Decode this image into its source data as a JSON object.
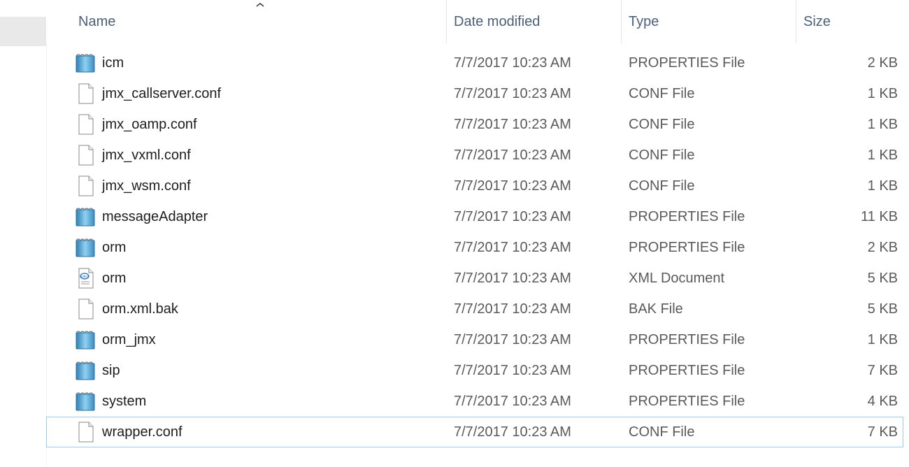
{
  "columns": {
    "name": "Name",
    "date": "Date modified",
    "type": "Type",
    "size": "Size"
  },
  "files": [
    {
      "name": "icm",
      "date": "7/7/2017 10:23 AM",
      "type": "PROPERTIES File",
      "size": "2 KB",
      "icon": "properties-file-icon"
    },
    {
      "name": "jmx_callserver.conf",
      "date": "7/7/2017 10:23 AM",
      "type": "CONF File",
      "size": "1 KB",
      "icon": "blank-file-icon"
    },
    {
      "name": "jmx_oamp.conf",
      "date": "7/7/2017 10:23 AM",
      "type": "CONF File",
      "size": "1 KB",
      "icon": "blank-file-icon"
    },
    {
      "name": "jmx_vxml.conf",
      "date": "7/7/2017 10:23 AM",
      "type": "CONF File",
      "size": "1 KB",
      "icon": "blank-file-icon"
    },
    {
      "name": "jmx_wsm.conf",
      "date": "7/7/2017 10:23 AM",
      "type": "CONF File",
      "size": "1 KB",
      "icon": "blank-file-icon"
    },
    {
      "name": "messageAdapter",
      "date": "7/7/2017 10:23 AM",
      "type": "PROPERTIES File",
      "size": "11 KB",
      "icon": "properties-file-icon"
    },
    {
      "name": "orm",
      "date": "7/7/2017 10:23 AM",
      "type": "PROPERTIES File",
      "size": "2 KB",
      "icon": "properties-file-icon"
    },
    {
      "name": "orm",
      "date": "7/7/2017 10:23 AM",
      "type": "XML Document",
      "size": "5 KB",
      "icon": "xml-document-icon"
    },
    {
      "name": "orm.xml.bak",
      "date": "7/7/2017 10:23 AM",
      "type": "BAK File",
      "size": "5 KB",
      "icon": "blank-file-icon"
    },
    {
      "name": "orm_jmx",
      "date": "7/7/2017 10:23 AM",
      "type": "PROPERTIES File",
      "size": "1 KB",
      "icon": "properties-file-icon"
    },
    {
      "name": "sip",
      "date": "7/7/2017 10:23 AM",
      "type": "PROPERTIES File",
      "size": "7 KB",
      "icon": "properties-file-icon"
    },
    {
      "name": "system",
      "date": "7/7/2017 10:23 AM",
      "type": "PROPERTIES File",
      "size": "4 KB",
      "icon": "properties-file-icon"
    },
    {
      "name": "wrapper.conf",
      "date": "7/7/2017 10:23 AM",
      "type": "CONF File",
      "size": "7 KB",
      "icon": "blank-file-icon",
      "selected": true
    }
  ],
  "colors": {
    "header_text": "#4c607a",
    "selection_border": "#99c9ef",
    "properties_icon": "#5aa9d6"
  }
}
